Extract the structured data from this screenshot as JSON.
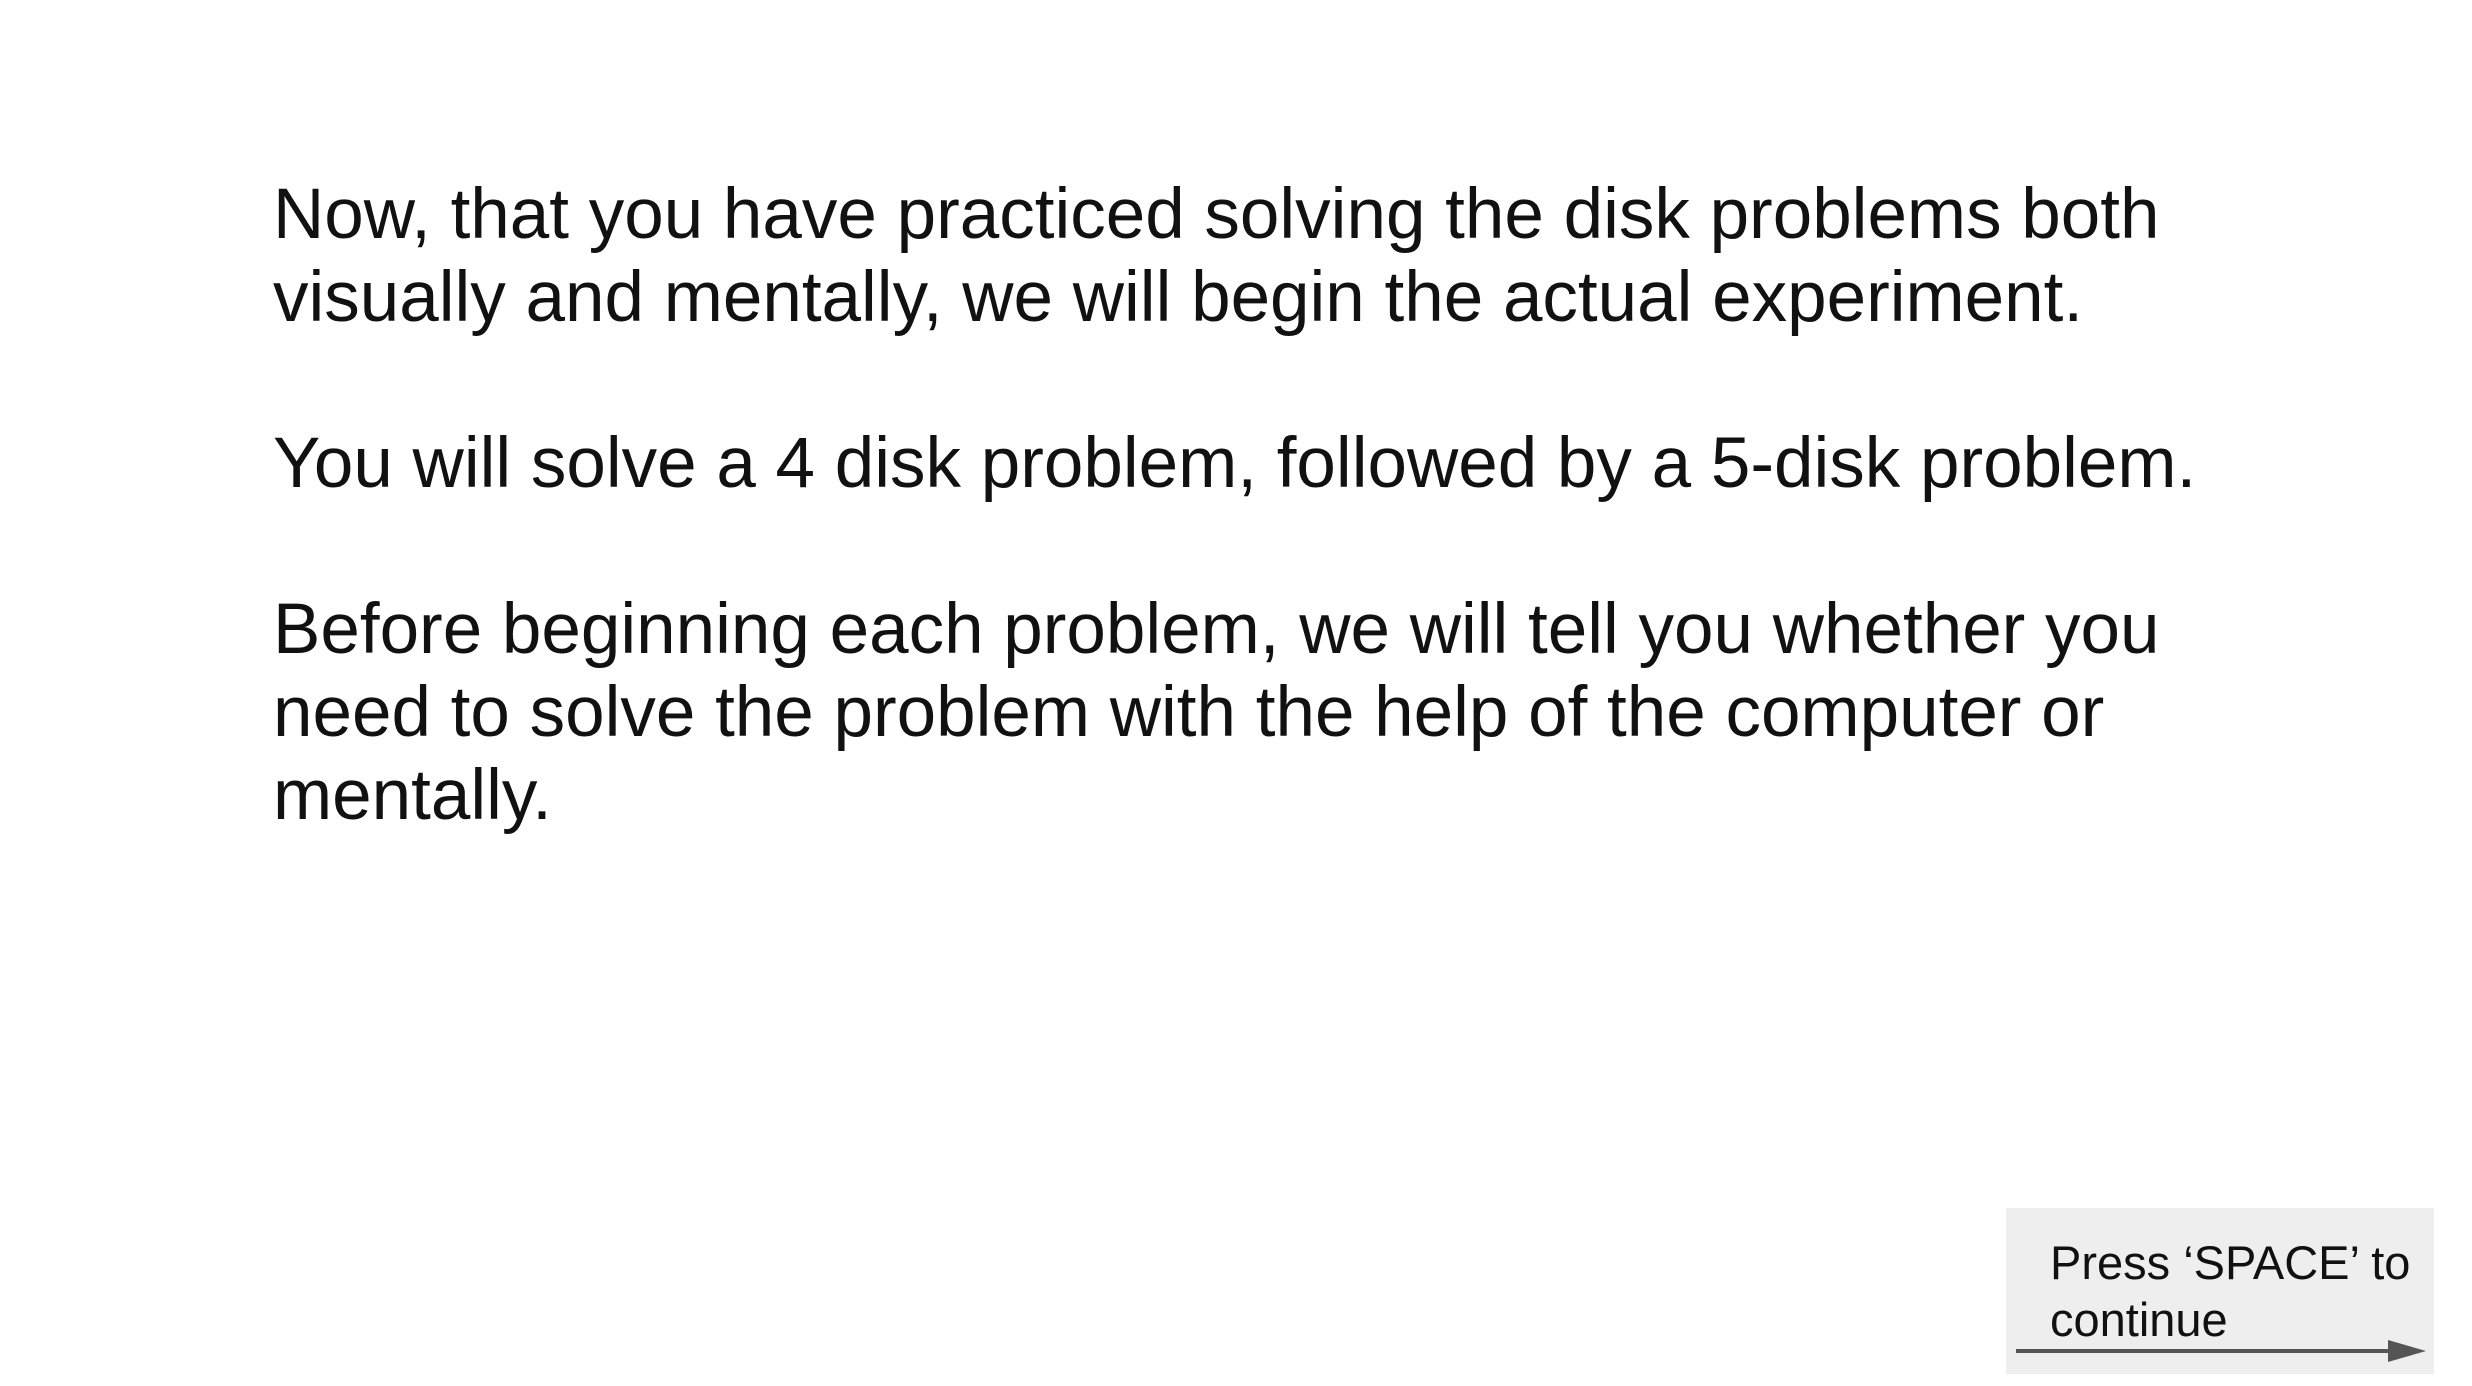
{
  "instructions": {
    "paragraph_1": "Now, that you have practiced solving the disk problems both\nvisually and mentally, we will begin the actual experiment.",
    "paragraph_2": "You will solve a 4 disk problem, followed by a 5-disk problem.",
    "paragraph_3": "Before beginning each problem, we will tell you whether you\nneed to solve the problem with the help of the computer or\nmentally."
  },
  "continue_prompt": {
    "label": "Press ‘SPACE’ to\ncontinue",
    "icon": "arrow-right-icon",
    "background_color": "#eeeeee",
    "arrow_color": "#555555"
  },
  "colors": {
    "background": "#ffffff",
    "text": "#111111"
  }
}
